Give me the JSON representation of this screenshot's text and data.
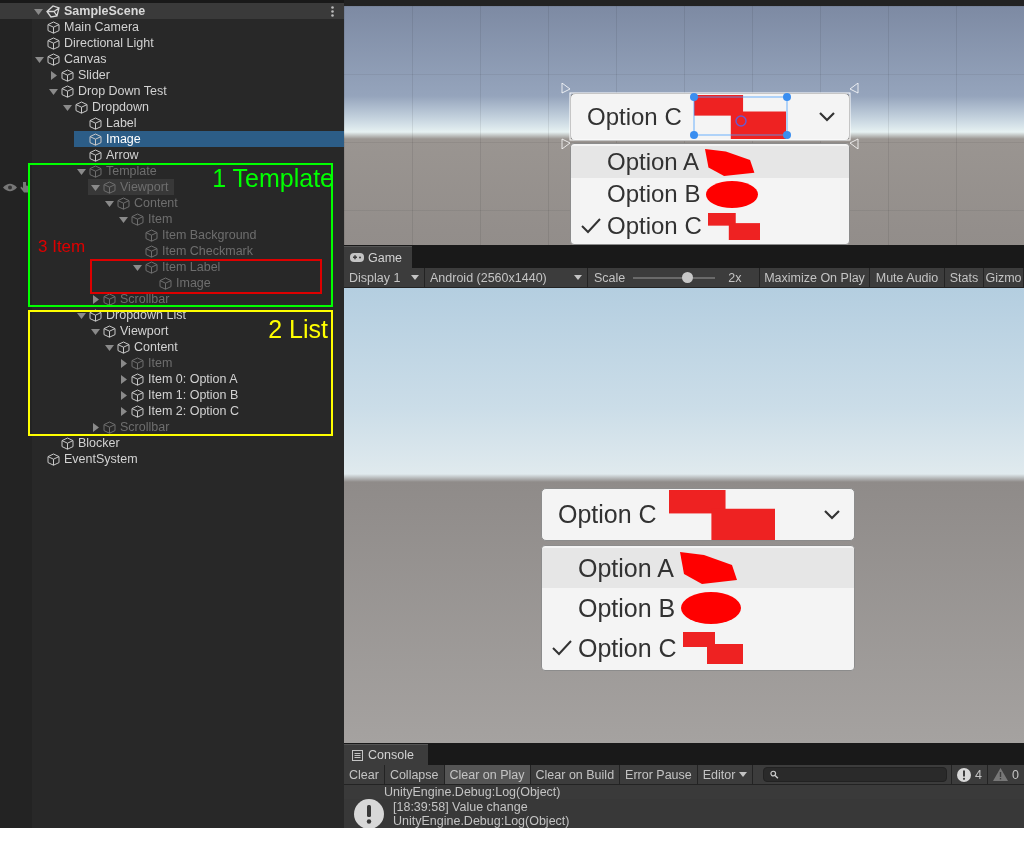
{
  "hierarchy": {
    "scene": "SampleScene",
    "items": [
      {
        "label": "Main Camera",
        "active": true,
        "selected": false,
        "hovered": false
      },
      {
        "label": "Directional Light",
        "active": true,
        "selected": false,
        "hovered": false
      },
      {
        "label": "Canvas",
        "active": true,
        "selected": false,
        "hovered": false,
        "expanded": true,
        "children": [
          {
            "label": "Slider",
            "active": true,
            "selected": false,
            "hovered": false,
            "expanded": false
          },
          {
            "label": "Drop Down Test",
            "active": true,
            "selected": false,
            "hovered": false,
            "expanded": true,
            "children": [
              {
                "label": "Dropdown",
                "active": true,
                "selected": false,
                "hovered": false,
                "expanded": true,
                "children": [
                  {
                    "label": "Label",
                    "active": true,
                    "selected": false,
                    "hovered": false
                  },
                  {
                    "label": "Image",
                    "active": true,
                    "selected": true,
                    "hovered": false
                  },
                  {
                    "label": "Arrow",
                    "active": true,
                    "selected": false,
                    "hovered": false
                  },
                  {
                    "label": "Template",
                    "active": false,
                    "selected": false,
                    "hovered": false,
                    "expanded": true,
                    "children": [
                      {
                        "label": "Viewport",
                        "active": false,
                        "selected": false,
                        "hovered": true,
                        "expanded": true,
                        "children": [
                          {
                            "label": "Content",
                            "active": false,
                            "selected": false,
                            "hovered": false,
                            "expanded": true,
                            "children": [
                              {
                                "label": "Item",
                                "active": false,
                                "selected": false,
                                "hovered": false,
                                "expanded": true,
                                "children": [
                                  {
                                    "label": "Item Background",
                                    "active": false,
                                    "selected": false,
                                    "hovered": false
                                  },
                                  {
                                    "label": "Item Checkmark",
                                    "active": false,
                                    "selected": false,
                                    "hovered": false
                                  },
                                  {
                                    "label": "Item Label",
                                    "active": false,
                                    "selected": false,
                                    "hovered": false,
                                    "expanded": true,
                                    "children": [
                                      {
                                        "label": "Image",
                                        "active": false,
                                        "selected": false,
                                        "hovered": false
                                      }
                                    ]
                                  }
                                ]
                              }
                            ]
                          }
                        ]
                      },
                      {
                        "label": "Scrollbar",
                        "active": false,
                        "selected": false,
                        "hovered": false,
                        "expanded": false
                      }
                    ]
                  },
                  {
                    "label": "Dropdown List",
                    "active": true,
                    "selected": false,
                    "hovered": false,
                    "expanded": true,
                    "children": [
                      {
                        "label": "Viewport",
                        "active": true,
                        "selected": false,
                        "hovered": false,
                        "expanded": true,
                        "children": [
                          {
                            "label": "Content",
                            "active": true,
                            "selected": false,
                            "hovered": false,
                            "expanded": true,
                            "children": [
                              {
                                "label": "Item",
                                "active": false,
                                "selected": false,
                                "hovered": false,
                                "expanded": false
                              },
                              {
                                "label": "Item 0: Option A",
                                "active": true,
                                "selected": false,
                                "hovered": false,
                                "expanded": false
                              },
                              {
                                "label": "Item 1: Option B",
                                "active": true,
                                "selected": false,
                                "hovered": false,
                                "expanded": false
                              },
                              {
                                "label": "Item 2: Option C",
                                "active": true,
                                "selected": false,
                                "hovered": false,
                                "expanded": false
                              }
                            ]
                          }
                        ]
                      },
                      {
                        "label": "Scrollbar",
                        "active": false,
                        "selected": false,
                        "hovered": false,
                        "expanded": false
                      }
                    ]
                  }
                ]
              }
            ]
          },
          {
            "label": "Blocker",
            "active": true,
            "selected": false,
            "hovered": false
          }
        ]
      },
      {
        "label": "EventSystem",
        "active": true,
        "selected": false,
        "hovered": false
      }
    ]
  },
  "annotations": [
    {
      "label": "1 Template",
      "color": "#00ff00"
    },
    {
      "label": "2 List",
      "color": "#ffff00"
    },
    {
      "label": "3 Item",
      "color": "#dd0000"
    }
  ],
  "scene_view": {
    "dropdown": {
      "caption": "Option C",
      "options": [
        {
          "label": "Option A",
          "selected": false,
          "highlighted": true
        },
        {
          "label": "Option B",
          "selected": false,
          "highlighted": false
        },
        {
          "label": "Option C",
          "selected": true,
          "highlighted": false
        }
      ]
    }
  },
  "game": {
    "tab": "Game",
    "display": "Display 1",
    "resolution": "Android (2560x1440)",
    "scale_label": "Scale",
    "scale": {
      "level": 0.65
    },
    "scale_value": "2x",
    "toggles": [
      {
        "label": "Maximize On Play",
        "on": false
      },
      {
        "label": "Mute Audio",
        "on": false
      },
      {
        "label": "Stats",
        "on": false
      },
      {
        "label": "Gizmo",
        "on": false
      }
    ],
    "dropdown": {
      "caption": "Option C",
      "options": [
        {
          "label": "Option A",
          "selected": false,
          "highlighted": true
        },
        {
          "label": "Option B",
          "selected": false,
          "highlighted": false
        },
        {
          "label": "Option C",
          "selected": true,
          "highlighted": false
        }
      ]
    }
  },
  "console": {
    "tab": "Console",
    "buttons": [
      {
        "label": "Clear",
        "on": false
      },
      {
        "label": "Collapse",
        "on": false
      },
      {
        "label": "Clear on Play",
        "on": true
      },
      {
        "label": "Clear on Build",
        "on": false
      },
      {
        "label": "Error Pause",
        "on": false
      }
    ],
    "editor": "Editor",
    "info_count": "4",
    "warning_count": "0",
    "entries": [
      {
        "trace": "UnityEngine.Debug:Log(Object)"
      },
      {
        "message": "[18:39:58] Value change",
        "trace": "UnityEngine.Debug:Log(Object)"
      }
    ]
  }
}
